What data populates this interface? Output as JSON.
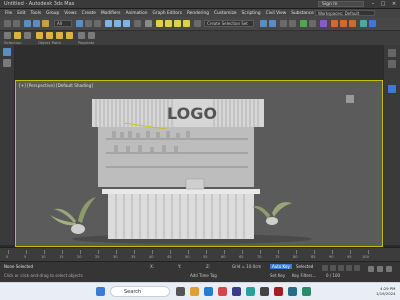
{
  "window": {
    "title": "Untitled - Autodesk 3ds Max",
    "signin_label": "Sign In",
    "workspace_label": "Workspaces: Default"
  },
  "menu": {
    "items": [
      "File",
      "Edit",
      "Tools",
      "Group",
      "Views",
      "Create",
      "Modifiers",
      "Animation",
      "Graph Editors",
      "Rendering",
      "Customize",
      "Scripting",
      "Civil View",
      "Substance",
      "V-Ray",
      "Arnold",
      "Help"
    ]
  },
  "toolbar": {
    "selection_filter": "All",
    "named_selection": "Create Selection Set"
  },
  "ribbon": {
    "groups": [
      "Selection",
      "Object Paint",
      "Populate"
    ]
  },
  "viewport": {
    "label": "[+] [Perspective] [Default Shading]",
    "sign_text": "LOGO"
  },
  "timeline": {
    "frame_counter": "0 / 100",
    "ticks": [
      "0",
      "5",
      "10",
      "15",
      "20",
      "25",
      "30",
      "35",
      "40",
      "45",
      "50",
      "55",
      "60",
      "65",
      "70",
      "75",
      "80",
      "85",
      "90",
      "95",
      "100"
    ]
  },
  "status": {
    "selection": "None Selected",
    "prompt": "Click or click-and-drag to select objects",
    "x_label": "X:",
    "y_label": "Y:",
    "z_label": "Z:",
    "grid": "Grid = 10.0cm",
    "auto_key": "Auto Key",
    "selected": "Selected",
    "set_key": "Set Key",
    "key_filters": "Key Filters...",
    "add_time_tag": "Add Time Tag"
  },
  "taskbar": {
    "search_placeholder": "Search",
    "time": "4:29 PM",
    "date": "1/19/2024"
  },
  "colors": {
    "viewport_border": "#c9c100",
    "booth": "#d9d9d9",
    "accent": "#3a7bd5"
  }
}
